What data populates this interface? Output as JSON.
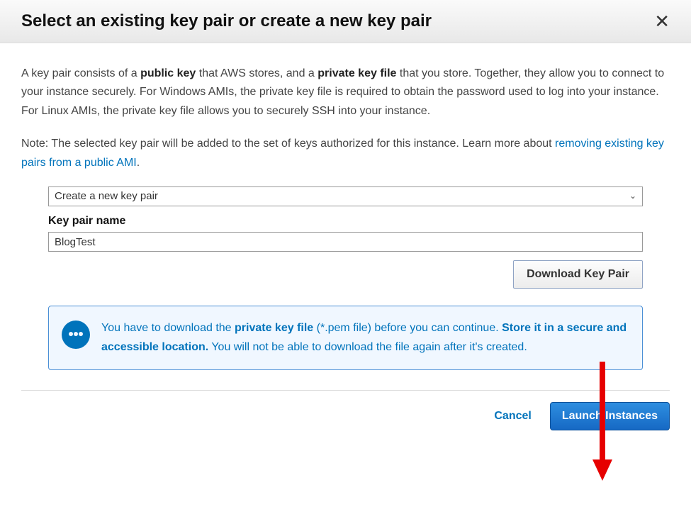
{
  "header": {
    "title": "Select an existing key pair or create a new key pair"
  },
  "description": {
    "pre1": "A key pair consists of a ",
    "bold1": "public key",
    "mid1": " that AWS stores, and a ",
    "bold2": "private key file",
    "post1": " that you store. Together, they allow you to connect to your instance securely. For Windows AMIs, the private key file is required to obtain the password used to log into your instance. For Linux AMIs, the private key file allows you to securely SSH into your instance."
  },
  "note": {
    "pre": "Note: The selected key pair will be added to the set of keys authorized for this instance. Learn more about ",
    "link": "removing existing key pairs from a public AMI",
    "post": "."
  },
  "form": {
    "select_value": "Create a new key pair",
    "label_name": "Key pair name",
    "name_value": "BlogTest",
    "download_label": "Download Key Pair"
  },
  "info": {
    "pre": "You have to download the ",
    "bold1": "private key file",
    "mid1": " (*.pem file) before you can continue. ",
    "bold2": "Store it in a secure and accessible location.",
    "post": " You will not be able to download the file again after it's created."
  },
  "footer": {
    "cancel": "Cancel",
    "launch": "Launch Instances"
  }
}
